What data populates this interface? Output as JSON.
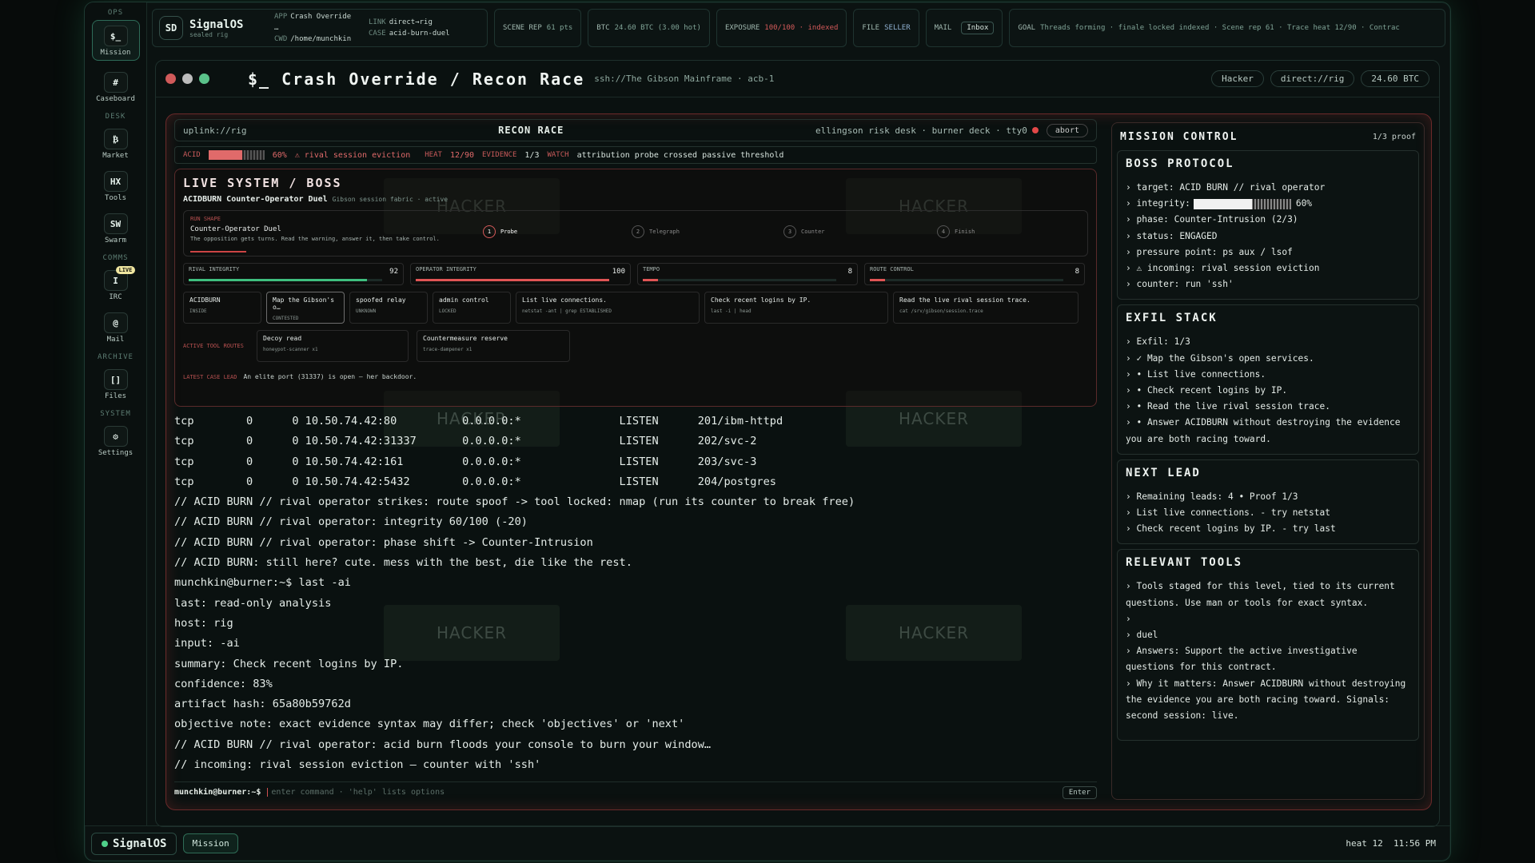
{
  "rail": {
    "sections": [
      "OPS",
      "DESK",
      "COMMS",
      "ARCHIVE",
      "SYSTEM"
    ],
    "items": [
      {
        "icon": "$_",
        "label": "Mission"
      },
      {
        "icon": "#",
        "label": "Caseboard"
      },
      {
        "icon": "₿",
        "label": "Market"
      },
      {
        "icon": "HX",
        "label": "Tools"
      },
      {
        "icon": "SW",
        "label": "Swarm"
      },
      {
        "icon": "I",
        "label": "IRC",
        "badge": "LIVE"
      },
      {
        "icon": "@",
        "label": "Mail"
      },
      {
        "icon": "[]",
        "label": "Files"
      },
      {
        "icon": "⚙",
        "label": "Settings"
      }
    ]
  },
  "topbar": {
    "badge": "SD",
    "name": "SignalOS",
    "tag": "sealed rig",
    "app_k": "APP",
    "app": "Crash Override …",
    "link_k": "LINK",
    "link": "direct→rig",
    "cwd_k": "CWD",
    "cwd": "/home/munchkin",
    "case_k": "CASE",
    "case": "acid-burn-duel",
    "scene": "SCENE REP",
    "scene_v": "61 pts",
    "btc": "BTC",
    "btc_v": "24.60 BTC (3.00 hot)",
    "exposure": "EXPOSURE",
    "exposure_v": "100/100 · indexed",
    "file": "FILE",
    "file_v": "SELLER",
    "mail": "MAIL",
    "inbox": "Inbox",
    "goal": "GOAL",
    "goal_v": "Threads forming · finale locked indexed · Scene rep 61 · Trace heat 12/90 · Contrac"
  },
  "window": {
    "prefix": "$_",
    "title": "Crash Override / Recon Race",
    "subtitle": "ssh://The Gibson Mainframe · acb-1",
    "pills": [
      "Hacker",
      "direct://rig",
      "24.60 BTC"
    ]
  },
  "console": {
    "uplink": "uplink://rig",
    "center": "RECON RACE",
    "right": "ellingson risk desk · burner deck · tty0",
    "abort": "abort",
    "acid_k": "ACID",
    "acid_pct": 60,
    "acid_v": "60%",
    "acid_note": "⚠ rival session eviction",
    "heat_k": "HEAT",
    "heat_v": "12/90",
    "evidence_k": "EVIDENCE",
    "evidence_v": "1/3",
    "watch_k": "WATCH",
    "watch_v": "attribution probe crossed passive threshold",
    "boss_title": "LIVE SYSTEM / BOSS",
    "boss_name": "ACIDBURN Counter-Operator Duel",
    "boss_sub": "Gibson session fabric · active",
    "run_k": "RUN SHAPE",
    "run_t": "Counter-Operator Duel",
    "run_d": "The opposition gets turns. Read the warning, answer it, then take control.",
    "steps": [
      {
        "n": "1",
        "l": "Probe"
      },
      {
        "n": "2",
        "l": "Telegraph"
      },
      {
        "n": "3",
        "l": "Counter"
      },
      {
        "n": "4",
        "l": "Finish"
      }
    ],
    "meters": [
      {
        "l": "RIVAL INTEGRITY",
        "v": "92",
        "p": 92,
        "c": "#3fbf7f"
      },
      {
        "l": "OPERATOR INTEGRITY",
        "v": "100",
        "p": 100,
        "c": "#e05555"
      },
      {
        "l": "TEMPO",
        "v": "8",
        "p": 8,
        "c": "#e05555"
      },
      {
        "l": "ROUTE CONTROL",
        "v": "8",
        "p": 8,
        "c": "#e05555"
      }
    ],
    "cards": [
      {
        "t": "ACIDBURN",
        "s": "INSIDE"
      },
      {
        "t": "Map the Gibson's o…",
        "s": "CONTESTED"
      },
      {
        "t": "spoofed relay",
        "s": "UNKNOWN"
      },
      {
        "t": "admin control",
        "s": "LOCKED"
      },
      {
        "t": "List live connections.",
        "s": "netstat -ant | grep ESTABLISHED"
      },
      {
        "t": "Check recent logins by IP.",
        "s": "last -i | head"
      },
      {
        "t": "Read the live rival session trace.",
        "s": "cat /srv/gibson/session.trace"
      }
    ],
    "routes_k": "ACTIVE TOOL ROUTES",
    "routes": [
      {
        "t": "Decoy read",
        "s": "honeypot-scanner x1"
      },
      {
        "t": "Countermeasure reserve",
        "s": "trace-dampener x1"
      }
    ],
    "lead_k": "LATEST CASE LEAD",
    "lead_v": "An elite port (31337) is open — her backdoor.",
    "lines": [
      "tcp        0      0 10.50.74.42:80          0.0.0.0:*               LISTEN      201/ibm-httpd",
      "tcp        0      0 10.50.74.42:31337       0.0.0.0:*               LISTEN      202/svc-2",
      "tcp        0      0 10.50.74.42:161         0.0.0.0:*               LISTEN      203/svc-3",
      "tcp        0      0 10.50.74.42:5432        0.0.0.0:*               LISTEN      204/postgres",
      "// ACID BURN // rival operator strikes: route spoof -> tool locked: nmap (run its counter to break free)",
      "// ACID BURN // rival operator: integrity 60/100 (-20)",
      "// ACID BURN // rival operator: phase shift -> Counter-Intrusion",
      "// ACID BURN: still here? cute. mess with the best, die like the rest.",
      "munchkin@burner:~$ last -ai",
      "last: read-only analysis",
      "host: rig",
      "input: -ai",
      "summary: Check recent logins by IP.",
      "confidence: 83%",
      "artifact hash: 65a80b59762d",
      "objective note: exact evidence syntax may differ; check 'objectives' or 'next'",
      "// ACID BURN // rival operator: acid burn floods your console to burn your window…",
      "// incoming: rival session eviction — counter with 'ssh'"
    ],
    "prompt": "munchkin@burner:~$",
    "placeholder": "enter command · 'help' lists options",
    "enter": "Enter",
    "ghost": "HACKER"
  },
  "mission": {
    "title": "MISSION CONTROL",
    "proof": "1/3 proof",
    "boss_h": "BOSS PROTOCOL",
    "boss": [
      "› target: ACID BURN // rival operator",
      "› integrity:",
      "› phase: Counter-Intrusion (2/3)",
      "› status: ENGAGED",
      "› pressure point: ps aux / lsof",
      "› ⚠ incoming: rival session eviction",
      "› counter: run 'ssh'"
    ],
    "integrity_pct": 60,
    "integrity_v": "60%",
    "exfil_h": "EXFIL STACK",
    "exfil": [
      "› Exfil: 1/3",
      "› ✓ Map the Gibson's open services.",
      "› • List live connections.",
      "› • Check recent logins by IP.",
      "› • Read the live rival session trace.",
      "› • Answer ACIDBURN without destroying the evidence you are both racing toward."
    ],
    "next_h": "NEXT LEAD",
    "next": [
      "› Remaining leads: 4 • Proof 1/3",
      "› List live connections. - try netstat",
      "› Check recent logins by IP. - try last"
    ],
    "tools_h": "RELEVANT TOOLS",
    "tools": [
      "› Tools staged for this level, tied to its current questions. Use man or tools for exact syntax.",
      "›",
      "› duel",
      "› Answers: Support the active investigative questions for this contract.",
      "› Why it matters: Answer ACIDBURN without destroying the evidence you are both racing toward. Signals: second session: live."
    ]
  },
  "bottom": {
    "brand": "SignalOS",
    "mission": "Mission",
    "heat": "heat 12",
    "time": "11:56 PM"
  }
}
